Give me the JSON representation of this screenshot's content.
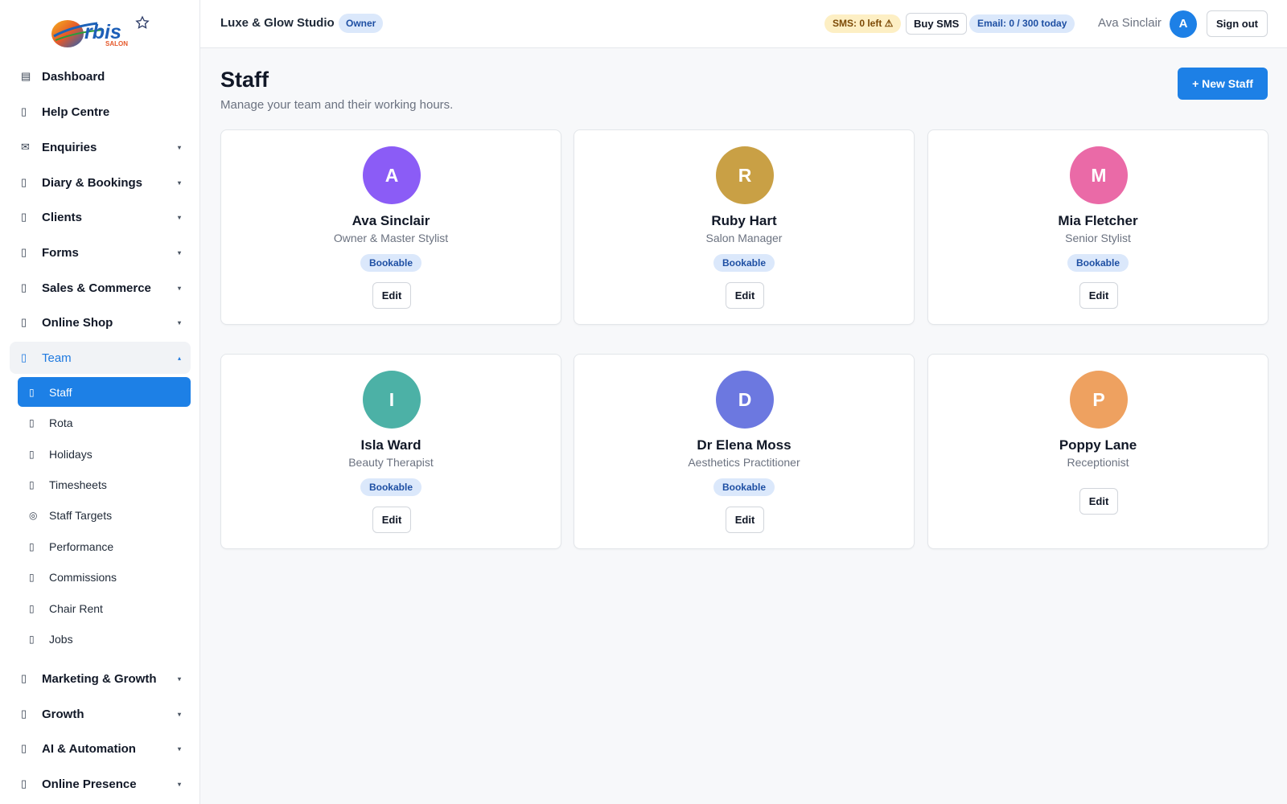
{
  "brand": {
    "logo_text": "rbis",
    "logo_sub": "SALON"
  },
  "sidebar": {
    "items": [
      {
        "label": "Dashboard",
        "icon": "dashboard-icon",
        "glyph": "▤",
        "caret": false
      },
      {
        "label": "Help Centre",
        "icon": "help-icon",
        "glyph": "▯",
        "caret": false
      },
      {
        "label": "Enquiries",
        "icon": "envelope-icon",
        "glyph": "✉",
        "caret": true
      },
      {
        "label": "Diary & Bookings",
        "icon": "calendar-icon",
        "glyph": "▯",
        "caret": true
      },
      {
        "label": "Clients",
        "icon": "clients-icon",
        "glyph": "▯",
        "caret": true
      },
      {
        "label": "Forms",
        "icon": "forms-icon",
        "glyph": "▯",
        "caret": true
      },
      {
        "label": "Sales & Commerce",
        "icon": "sales-icon",
        "glyph": "▯",
        "caret": true
      },
      {
        "label": "Online Shop",
        "icon": "shop-icon",
        "glyph": "▯",
        "caret": true
      },
      {
        "label": "Team",
        "icon": "team-icon",
        "glyph": "▯",
        "caret": true,
        "open": true
      },
      {
        "label": "Marketing & Growth",
        "icon": "marketing-icon",
        "glyph": "▯",
        "caret": true
      },
      {
        "label": "Growth",
        "icon": "growth-icon",
        "glyph": "▯",
        "caret": true
      },
      {
        "label": "AI & Automation",
        "icon": "ai-icon",
        "glyph": "▯",
        "caret": true
      },
      {
        "label": "Online Presence",
        "icon": "globe-icon",
        "glyph": "▯",
        "caret": true
      }
    ],
    "team_sub": [
      {
        "label": "Staff",
        "icon": "staff-icon",
        "glyph": "▯",
        "active": true
      },
      {
        "label": "Rota",
        "icon": "rota-icon",
        "glyph": "▯"
      },
      {
        "label": "Holidays",
        "icon": "holidays-icon",
        "glyph": "▯"
      },
      {
        "label": "Timesheets",
        "icon": "timesheets-icon",
        "glyph": "▯"
      },
      {
        "label": "Staff Targets",
        "icon": "target-icon",
        "glyph": "◎"
      },
      {
        "label": "Performance",
        "icon": "performance-icon",
        "glyph": "▯"
      },
      {
        "label": "Commissions",
        "icon": "commissions-icon",
        "glyph": "▯"
      },
      {
        "label": "Chair Rent",
        "icon": "chair-icon",
        "glyph": "▯"
      },
      {
        "label": "Jobs",
        "icon": "jobs-icon",
        "glyph": "▯"
      }
    ],
    "caret_down": "▾",
    "caret_up": "▴"
  },
  "header": {
    "studio_name": "Luxe & Glow Studio",
    "role_badge": "Owner",
    "sms_status": "SMS: 0 left ⚠",
    "buy_sms": "Buy SMS",
    "email_status": "Email: 0 / 300 today",
    "user_name": "Ava Sinclair",
    "user_initial": "A",
    "sign_out": "Sign out"
  },
  "main": {
    "title": "Staff",
    "subtitle": "Manage your team and their working hours.",
    "new_staff_button": "+ New Staff",
    "edit_label": "Edit",
    "staff": [
      {
        "initial": "A",
        "name": "Ava Sinclair",
        "role": "Owner & Master Stylist",
        "badge": "Bookable",
        "color": "#8b5cf6"
      },
      {
        "initial": "R",
        "name": "Ruby Hart",
        "role": "Salon Manager",
        "badge": "Bookable",
        "color": "#c9a045"
      },
      {
        "initial": "M",
        "name": "Mia Fletcher",
        "role": "Senior Stylist",
        "badge": "Bookable",
        "color": "#ea6aa7"
      },
      {
        "initial": "I",
        "name": "Isla Ward",
        "role": "Beauty Therapist",
        "badge": "Bookable",
        "color": "#4cb1a6"
      },
      {
        "initial": "D",
        "name": "Dr Elena Moss",
        "role": "Aesthetics Practitioner",
        "badge": "Bookable",
        "color": "#6c78e0"
      },
      {
        "initial": "P",
        "name": "Poppy Lane",
        "role": "Receptionist",
        "badge": "",
        "color": "#eea160"
      }
    ]
  },
  "colors": {
    "accent": "#1d80e6",
    "badge_bg": "#dbe8fb",
    "warning_bg": "#fdefc4"
  }
}
